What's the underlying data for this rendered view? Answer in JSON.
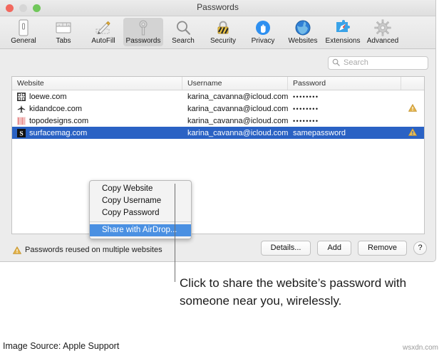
{
  "window": {
    "title": "Passwords",
    "traffic_lights": [
      "close-red",
      "minimize-gray",
      "zoom-green"
    ]
  },
  "toolbar": {
    "items": [
      {
        "label": "General",
        "icon": "general-icon",
        "selected": false
      },
      {
        "label": "Tabs",
        "icon": "tabs-icon",
        "selected": false
      },
      {
        "label": "AutoFill",
        "icon": "autofill-icon",
        "selected": false
      },
      {
        "label": "Passwords",
        "icon": "key-icon",
        "selected": true
      },
      {
        "label": "Search",
        "icon": "magnifier-icon",
        "selected": false
      },
      {
        "label": "Security",
        "icon": "lock-icon",
        "selected": false
      },
      {
        "label": "Privacy",
        "icon": "hand-icon",
        "selected": false
      },
      {
        "label": "Websites",
        "icon": "globe-icon",
        "selected": false
      },
      {
        "label": "Extensions",
        "icon": "puzzle-icon",
        "selected": false
      },
      {
        "label": "Advanced",
        "icon": "gear-icon",
        "selected": false
      }
    ]
  },
  "search": {
    "placeholder": "Search",
    "value": "",
    "icon": "search-icon"
  },
  "table": {
    "columns": [
      "Website",
      "Username",
      "Password",
      ""
    ],
    "rows": [
      {
        "website": "loewe.com",
        "favicon": "grid-favicon",
        "username": "karina_cavanna@icloud.com",
        "password": "••••••••",
        "warning": false,
        "selected": false
      },
      {
        "website": "kidandcoe.com",
        "favicon": "airplane-favicon",
        "username": "karina_cavanna@icloud.com",
        "password": "••••••••",
        "warning": true,
        "selected": false
      },
      {
        "website": "topodesigns.com",
        "favicon": "stripes-favicon",
        "username": "karina_cavanna@icloud.com",
        "password": "••••••••",
        "warning": false,
        "selected": false
      },
      {
        "website": "surfacemag.com",
        "favicon": "letter-s-favicon",
        "username": "karina_cavanna@icloud.com",
        "password": "samepassword",
        "warning": true,
        "selected": true
      }
    ]
  },
  "context_menu": {
    "items": [
      {
        "label": "Copy Website",
        "highlighted": false
      },
      {
        "label": "Copy Username",
        "highlighted": false
      },
      {
        "label": "Copy Password",
        "highlighted": false
      },
      {
        "label": "Share with AirDrop...",
        "highlighted": true
      }
    ]
  },
  "status": {
    "icon": "warning-triangle-icon",
    "text": "Passwords reused on multiple websites"
  },
  "buttons": {
    "details": "Details...",
    "add": "Add",
    "remove": "Remove",
    "help": "?"
  },
  "annotation": {
    "callout": "Click to share the website’s password with someone near you, wirelessly."
  },
  "footer": {
    "source": "Image Source: Apple Support",
    "watermark": "wsxdn.com"
  },
  "colors": {
    "selection_blue": "#2a62c4",
    "menu_highlight": "#4a90e2",
    "warning_gold": "#d6a537",
    "window_gray": "#ececec"
  }
}
